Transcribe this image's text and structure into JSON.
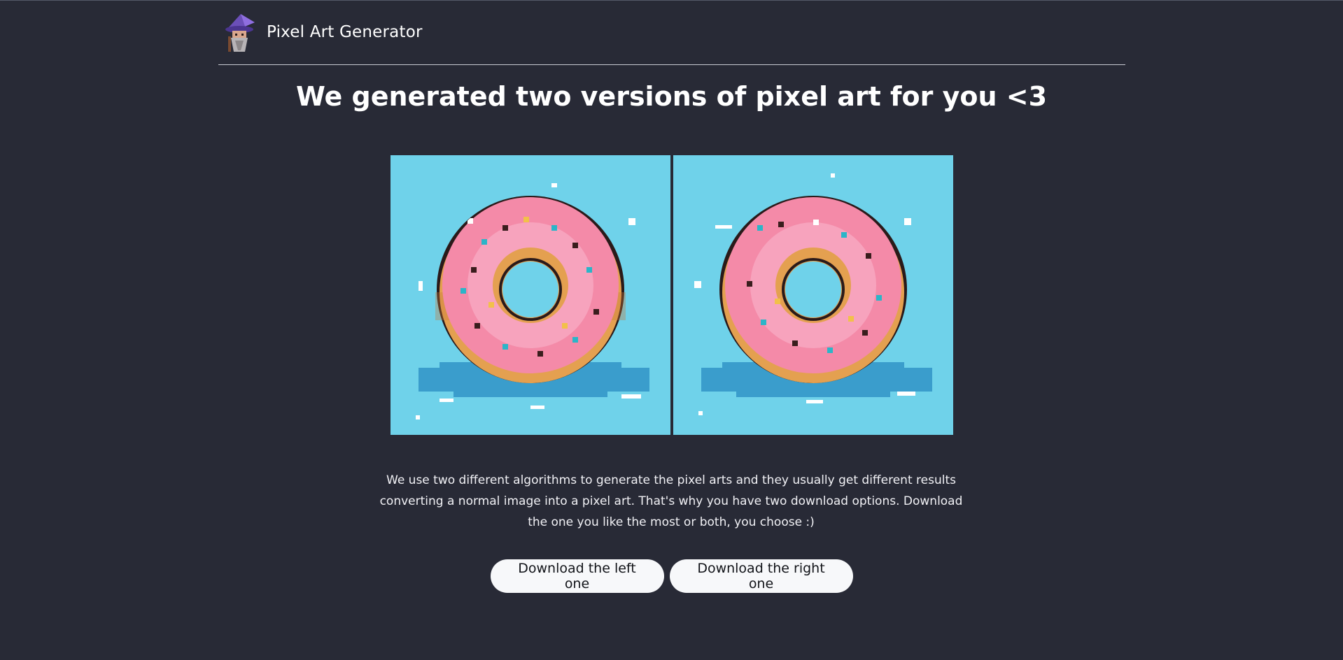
{
  "header": {
    "brand": "Pixel Art Generator",
    "logo_icon": "wizard-avatar-icon"
  },
  "main": {
    "heading": "We generated two versions of pixel art for you <3",
    "images": [
      {
        "name": "left-pixel-art",
        "subject": "pink-sprinkled-donut-icon"
      },
      {
        "name": "right-pixel-art",
        "subject": "pink-sprinkled-donut-icon"
      }
    ],
    "description": "We use two different algorithms to generate the pixel arts and they usually get different results converting a normal image into a pixel art. That's why you have two download options. Download the one you like the most or both, you choose :)",
    "buttons": {
      "left": "Download the left one",
      "right": "Download the right one"
    }
  },
  "colors": {
    "background": "#282a36",
    "art_background": "#6fd2ea",
    "button_background": "#f7f8fa",
    "donut_icing": "#f48aa8",
    "donut_dough": "#e4a050"
  }
}
